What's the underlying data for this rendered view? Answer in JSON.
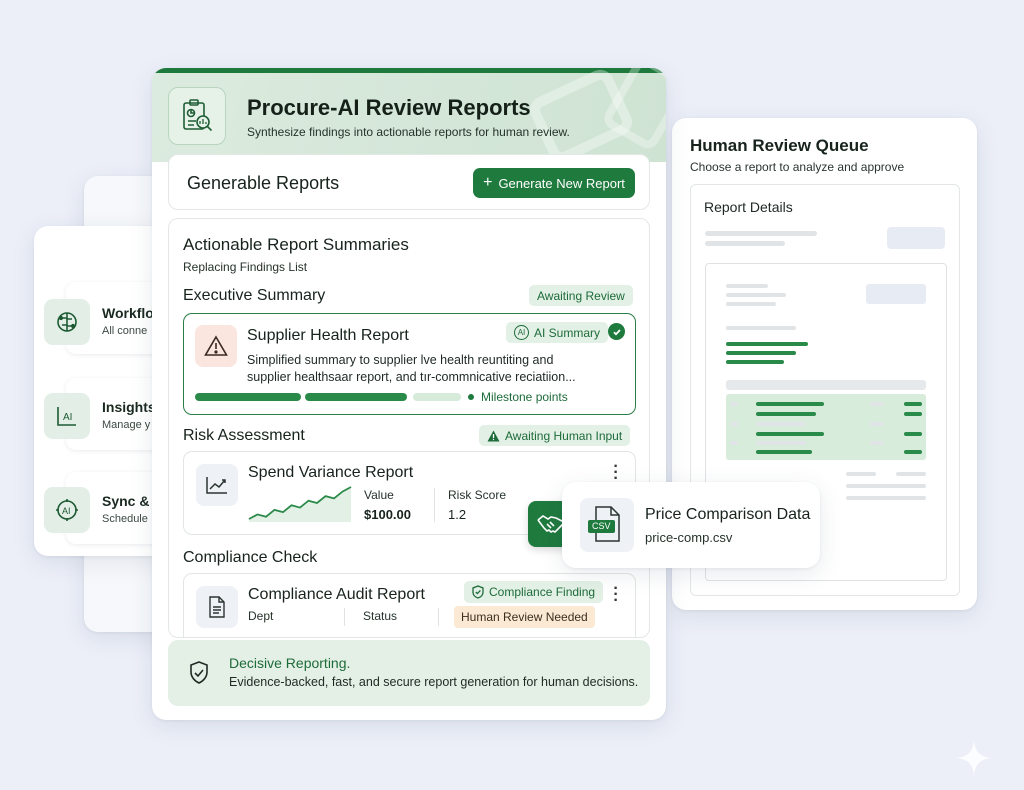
{
  "app": {
    "title": "Procure-AI Review Reports",
    "subtitle": "Synthesize findings into actionable reports for human review."
  },
  "colors": {
    "accent": "#1f7a3e",
    "accent_light": "#e2f0e5",
    "warning_bg": "#fbe5df",
    "human_needed_bg": "#fbe9d4"
  },
  "left_panel": {
    "items": [
      {
        "title": "Workflo",
        "sub": "All conne",
        "icon": "brain-circuit-icon"
      },
      {
        "title": "Insights",
        "sub": "Manage y",
        "icon": "ai-chart-icon"
      },
      {
        "title": "Sync & ",
        "sub": "Schedule",
        "icon": "ai-chip-icon"
      }
    ]
  },
  "generable": {
    "title": "Generable Reports",
    "button": "Generate New Report"
  },
  "summaries": {
    "title": "Actionable Report Summaries",
    "subtitle": "Replacing Findings List",
    "executive": {
      "heading": "Executive Summary",
      "status": "Awaiting Review",
      "card": {
        "title": "Supplier Health Report",
        "badge": "AI Summary",
        "description": "Simplified summary to supplier lve health reuntiting and supplier healthsaar report, and tır-commnicative reciatiion...",
        "progress_label": "Milestone points"
      }
    },
    "risk": {
      "heading": "Risk Assessment",
      "status": "Awaiting Human Input",
      "card": {
        "title": "Spend Variance Report",
        "value_label": "Value",
        "value": "$100.00",
        "score_label": "Risk Score",
        "score": "1.2",
        "sparkline": [
          2,
          3,
          2.5,
          4,
          3.5,
          5,
          4.5,
          6,
          5.5,
          7,
          6.5,
          8,
          9
        ]
      }
    },
    "compliance": {
      "heading": "Compliance Check",
      "card": {
        "title": "Compliance Audit Report",
        "badge": "Compliance Finding",
        "col1": "Dept",
        "col2": "Status",
        "status_tag": "Human Review Needed"
      }
    }
  },
  "footer": {
    "title": "Decisive Reporting.",
    "text": "Evidence-backed, fast, and secure report generation for human decisions."
  },
  "queue": {
    "title": "Human Review Queue",
    "subtitle": "Choose a report to analyze and approve",
    "details_title": "Report Details"
  },
  "attachment": {
    "title": "Price Comparison Data",
    "filename": "price-comp.csv",
    "file_tag": "CSV"
  }
}
